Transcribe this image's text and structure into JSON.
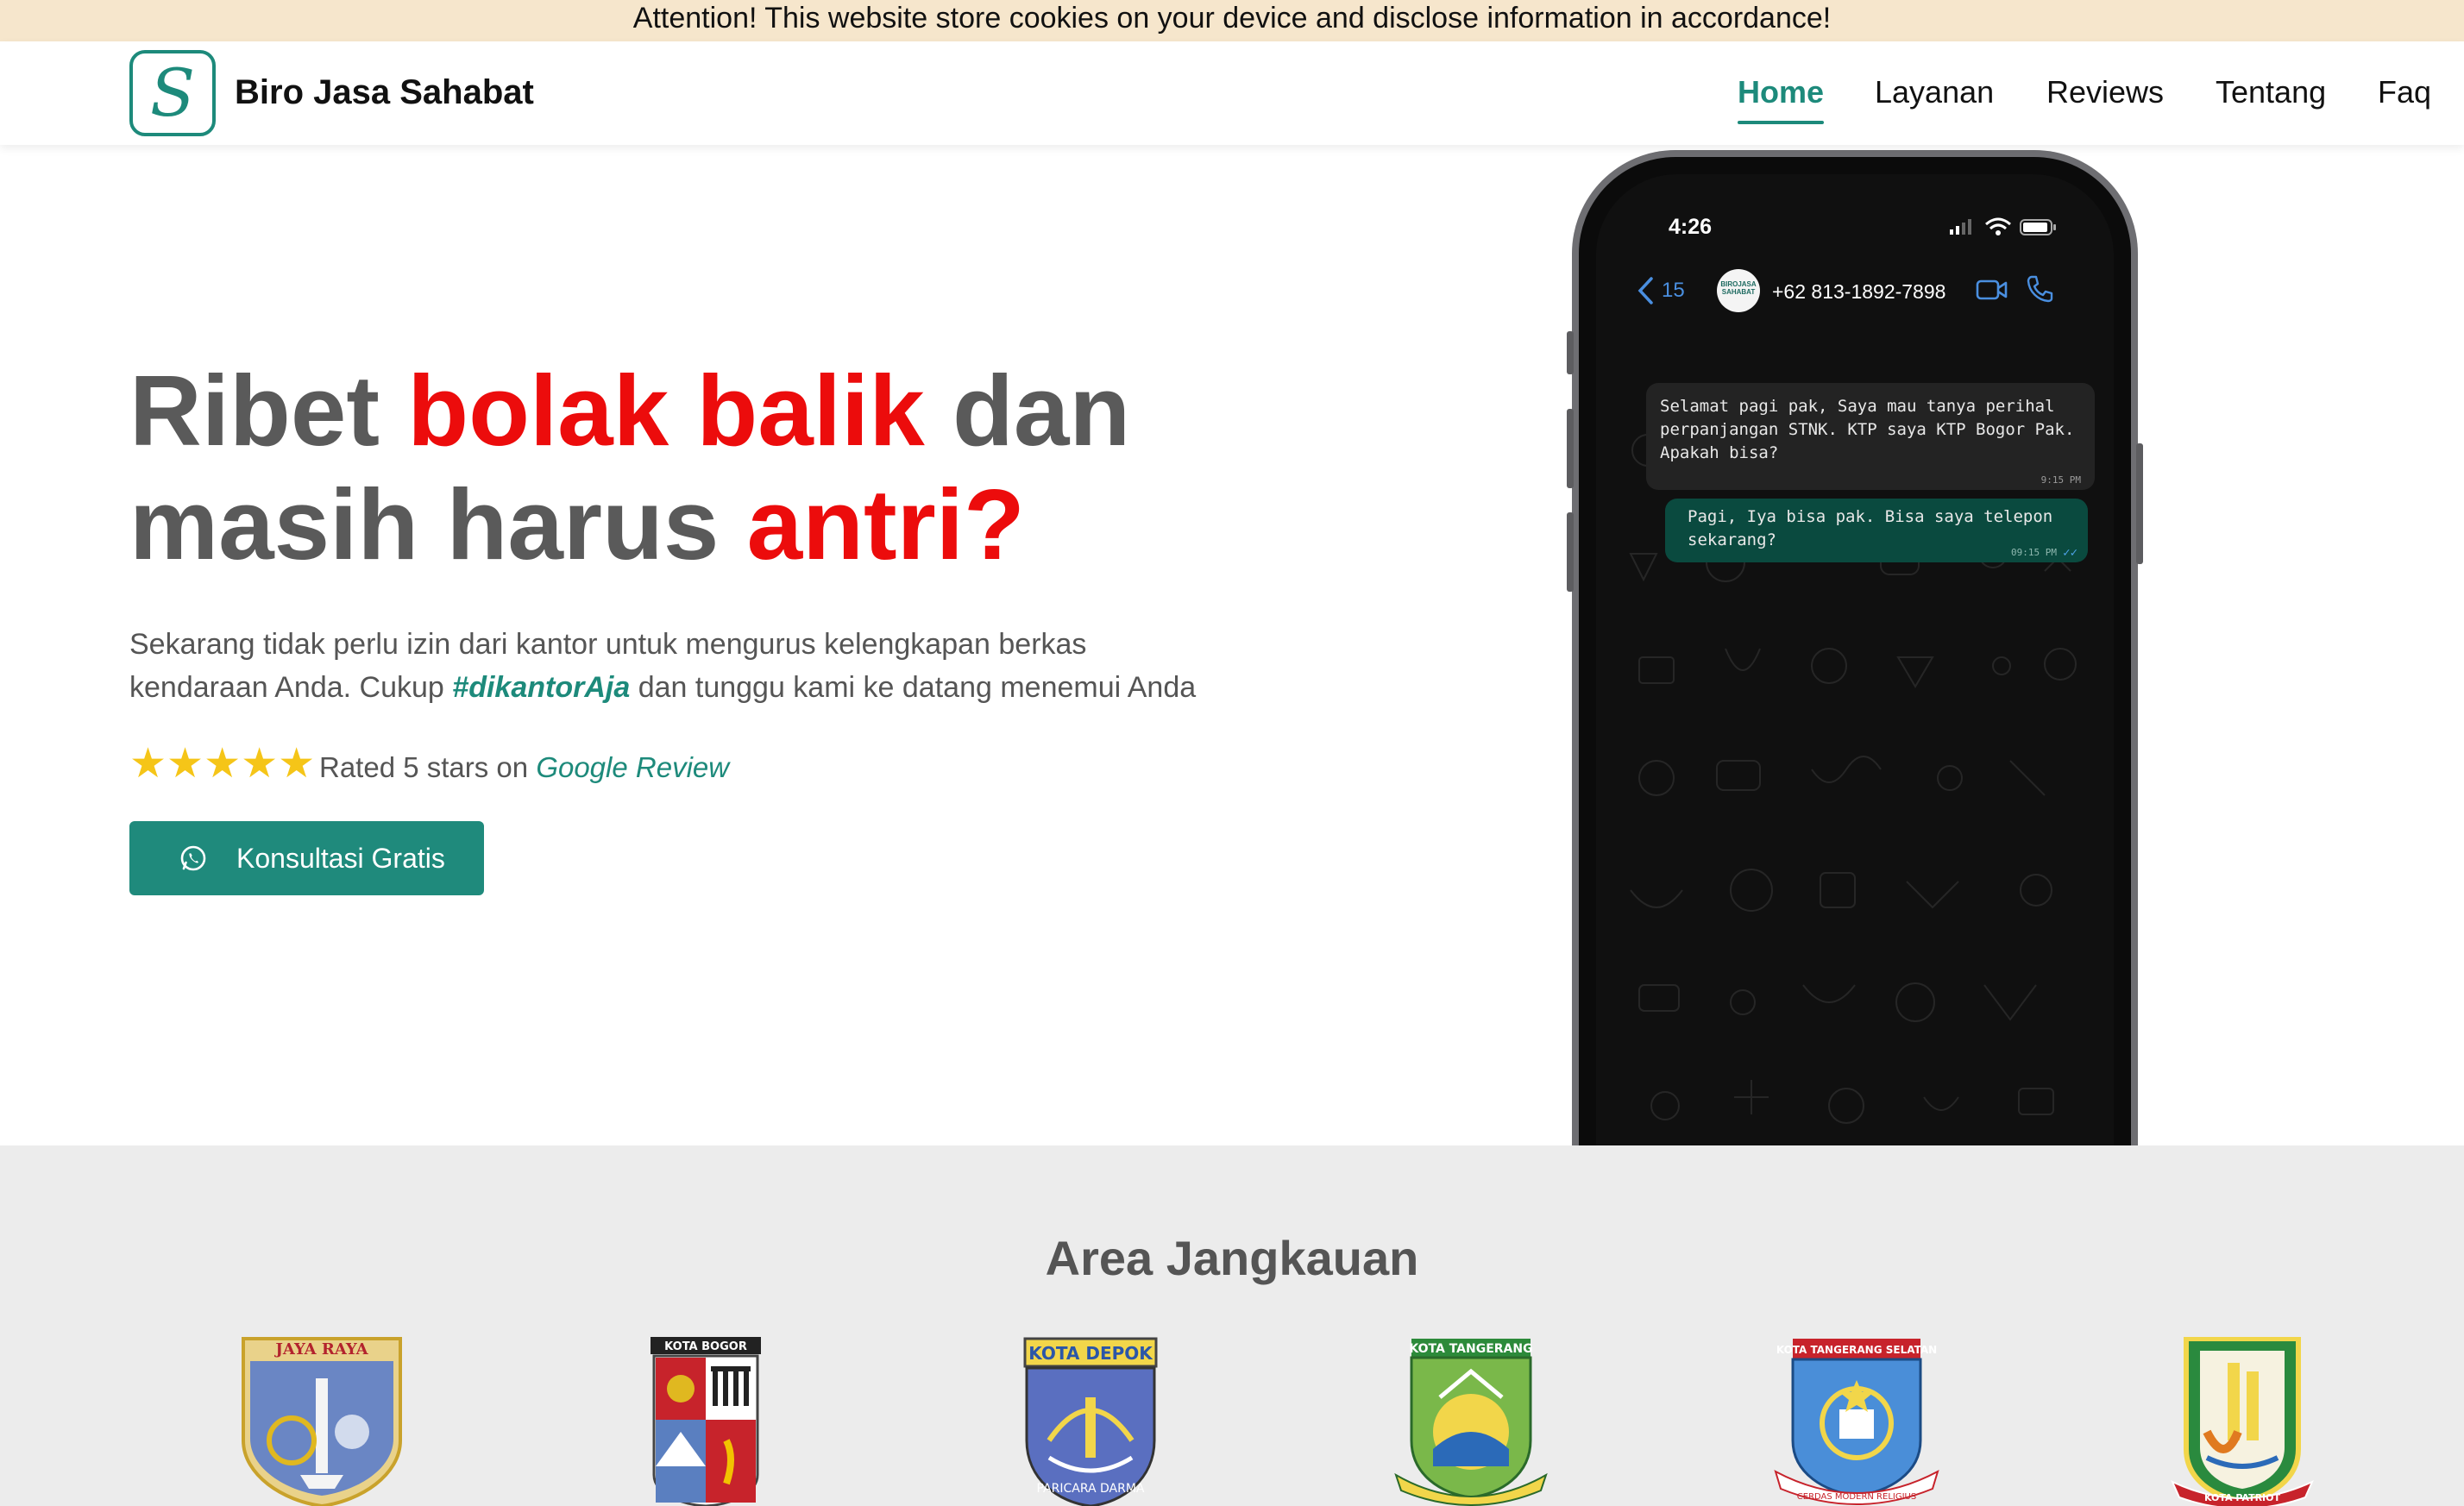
{
  "cookie_banner": {
    "text": "Attention! This website store cookies on your device and disclose information in accordance!"
  },
  "header": {
    "logo_letter": "S",
    "brand": "Biro Jasa Sahabat",
    "nav": [
      {
        "label": "Home",
        "active": true
      },
      {
        "label": "Layanan",
        "active": false
      },
      {
        "label": "Reviews",
        "active": false
      },
      {
        "label": "Tentang",
        "active": false
      },
      {
        "label": "Faq",
        "active": false
      }
    ]
  },
  "hero": {
    "title_line1_a": "Ribet ",
    "title_line1_b": "bolak balik",
    "title_line1_c": " dan",
    "title_line2_a": "masih harus ",
    "title_line2_b": "antri?",
    "desc_line1": "Sekarang tidak perlu izin dari kantor untuk mengurus kelengkapan berkas",
    "desc_line2_a": "kendaraan Anda. Cukup ",
    "desc_hashtag": "#dikantorAja",
    "desc_line2_b": " dan tunggu kami ke datang menemui Anda",
    "rating_stars": 5,
    "rating_prefix": "Rated 5 stars on ",
    "rating_source": "Google Review",
    "cta_label": "Konsultasi Gratis",
    "accent_color": "#1f8a7c",
    "highlight_color": "#ec0c0c"
  },
  "phone": {
    "time": "4:26",
    "back_count": "15",
    "contact_avatar_text": "BIROJASA SAHABAT",
    "contact_number": "+62 813-1892-7898",
    "messages": [
      {
        "direction": "in",
        "text": "Selamat pagi pak, Saya mau tanya perihal perpanjangan STNK. KTP saya KTP Bogor Pak. Apakah bisa?",
        "time": "9:15 PM"
      },
      {
        "direction": "out",
        "text": "Pagi, Iya bisa pak. Bisa saya telepon sekarang?",
        "time": "09:15 PM"
      }
    ]
  },
  "area": {
    "title": "Area Jangkauan",
    "emblems": [
      {
        "label": "JAYA RAYA",
        "color": "#d4a21a"
      },
      {
        "label": "KOTA BOGOR",
        "color": "#b3232d"
      },
      {
        "label": "KOTA DEPOK",
        "color": "#2b56a8"
      },
      {
        "label": "KOTA TANGERANG",
        "color": "#2c8a3a"
      },
      {
        "label": "KOTA TANGERANG SELATAN",
        "color": "#1b6bb5"
      },
      {
        "label": "KOTA PATRIOT",
        "color": "#2a8a3e"
      }
    ],
    "emblem_subtexts": [
      "PARICARA DARMA",
      "CERDAS MODERN RELIGIUS",
      "KOTA PATRIOT"
    ]
  }
}
